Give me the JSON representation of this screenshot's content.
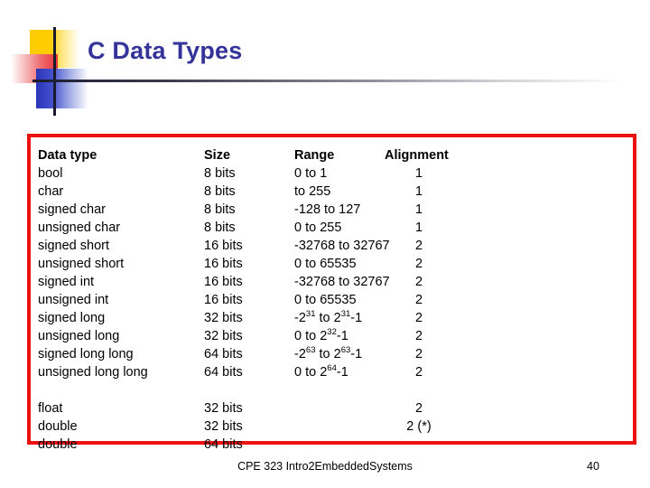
{
  "slide": {
    "title": "C Data Types",
    "title_color": "#333399",
    "table_border_color": "#EE1111",
    "footer": "CPE 323 Intro2EmbeddedSystems",
    "page_number": "40"
  },
  "table": {
    "headers": {
      "type": "Data type",
      "size": "Size",
      "range": "Range",
      "alignment": "Alignment"
    },
    "rows": [
      {
        "type": "bool",
        "size": "8 bits",
        "range": "0 to 1",
        "range_sup": "",
        "range_tail": "",
        "alignment": "1"
      },
      {
        "type": "char",
        "size": "8 bits",
        "range": " to 255",
        "range_sup": "",
        "range_tail": "",
        "alignment": "1"
      },
      {
        "type": "signed char",
        "size": "8 bits",
        "range": "-128 to 127",
        "range_sup": "",
        "range_tail": "",
        "alignment": "1"
      },
      {
        "type": "unsigned char",
        "size": "8 bits",
        "range": "0 to 255",
        "range_sup": "",
        "range_tail": "",
        "alignment": "1"
      },
      {
        "type": "signed short",
        "size": "16 bits",
        "range": "-32768 to 32767",
        "range_sup": "",
        "range_tail": "",
        "alignment": "2"
      },
      {
        "type": "unsigned short",
        "size": "16 bits",
        "range": "0 to 65535",
        "range_sup": "",
        "range_tail": "",
        "alignment": "2"
      },
      {
        "type": "signed int",
        "size": "16 bits",
        "range": "-32768 to 32767",
        "range_sup": "",
        "range_tail": "",
        "alignment": "2"
      },
      {
        "type": "unsigned int",
        "size": "16 bits",
        "range": "0 to 65535",
        "range_sup": "",
        "range_tail": "",
        "alignment": "2"
      },
      {
        "type": "signed long",
        "size": "32 bits",
        "range": "-2",
        "range_sup": "31",
        "range_tail": " to 2",
        "range_sup2": "31",
        "range_tail2": "-1",
        "alignment": "2"
      },
      {
        "type": "unsigned long",
        "size": "32 bits",
        "range": "0 to 2",
        "range_sup": "32",
        "range_tail": "-1",
        "alignment": "2"
      },
      {
        "type": "signed long long",
        "size": "64 bits",
        "range": "-2",
        "range_sup": "63",
        "range_tail": " to 2",
        "range_sup2": "63",
        "range_tail2": "-1",
        "alignment": "2"
      },
      {
        "type": "unsigned long long",
        "size": "64 bits",
        "range": "0 to 2",
        "range_sup": "64",
        "range_tail": "-1",
        "alignment": "2"
      }
    ],
    "float_rows": [
      {
        "type": "float",
        "size": "32 bits",
        "range": "",
        "alignment": "2"
      },
      {
        "type": "double",
        "size": "32 bits",
        "range": "",
        "alignment": "2 (*)"
      },
      {
        "type": "double",
        "size": "64 bits",
        "range": "",
        "alignment": ""
      }
    ]
  }
}
